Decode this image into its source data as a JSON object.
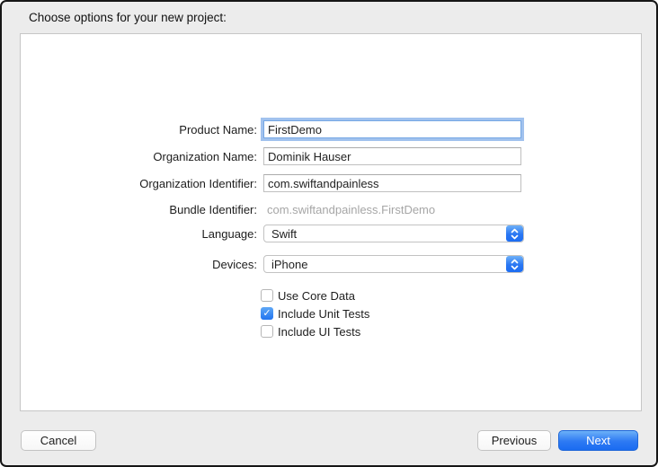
{
  "dialog": {
    "title": "Choose options for your new project:"
  },
  "form": {
    "fields": [
      {
        "label": "Product Name:",
        "value": "FirstDemo",
        "type": "text",
        "focused": true
      },
      {
        "label": "Organization Name:",
        "value": "Dominik Hauser",
        "type": "text",
        "focused": false
      },
      {
        "label": "Organization Identifier:",
        "value": "com.swiftandpainless",
        "type": "text",
        "focused": false
      },
      {
        "label": "Bundle Identifier:",
        "value": "com.swiftandpainless.FirstDemo",
        "type": "static",
        "focused": false
      },
      {
        "label": "Language:",
        "value": "Swift",
        "type": "popup",
        "focused": false
      },
      {
        "label": "Devices:",
        "value": "iPhone",
        "type": "popup",
        "focused": false
      }
    ],
    "checkboxes": [
      {
        "label": "Use Core Data",
        "checked": false
      },
      {
        "label": "Include Unit Tests",
        "checked": true
      },
      {
        "label": "Include UI Tests",
        "checked": false
      }
    ],
    "checkmark_glyph": "✓"
  },
  "footer": {
    "cancel_label": "Cancel",
    "previous_label": "Previous",
    "next_label": "Next"
  },
  "colors": {
    "accent_blue": "#2d79f3",
    "dialog_background": "#ececec",
    "panel_background": "#ffffff",
    "muted_text": "#a6a6a6"
  }
}
